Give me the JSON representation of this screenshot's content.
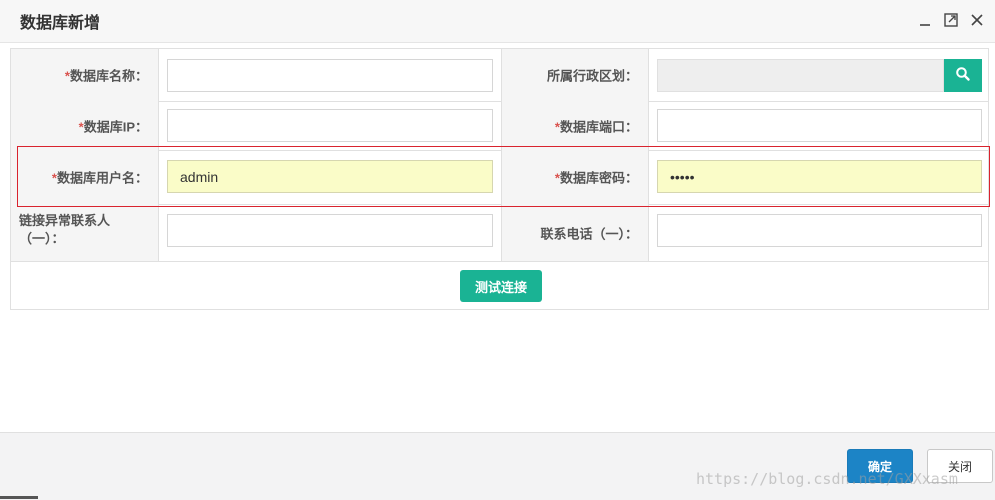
{
  "dialog": {
    "title": "数据库新增"
  },
  "header_icons": {
    "minimize": "minimize-icon",
    "maximize": "maximize-icon",
    "close": "close-icon"
  },
  "form": {
    "row1": {
      "left_label": "数据库名称：",
      "left_required": "*",
      "left_value": "",
      "right_label": "所属行政区划：",
      "right_value": "",
      "search_icon": "search-icon"
    },
    "row2": {
      "left_label": "数据库IP：",
      "left_required": "*",
      "left_value": "",
      "right_label": "数据库端口：",
      "right_required": "*",
      "right_value": ""
    },
    "row3": {
      "left_label": "数据库用户名：",
      "left_required": "*",
      "left_value": "admin",
      "right_label": "数据库密码：",
      "right_required": "*",
      "right_value": "•••••"
    },
    "row4": {
      "left_label_line1": "链接异常联系人",
      "left_label_line2": "（一）：",
      "left_value": "",
      "right_label": "联系电话（一）：",
      "right_value": ""
    },
    "test_button": "测试连接"
  },
  "footer": {
    "ok_label": "确定",
    "close_label": "关闭"
  },
  "watermark": "https://blog.csdn.net/GXXxasm",
  "colors": {
    "accent_green": "#1ab394",
    "primary_blue": "#1c84c6",
    "required_red": "#d9534f",
    "highlight_red": "#d9232e",
    "filled_yellow": "#fafcc8"
  }
}
